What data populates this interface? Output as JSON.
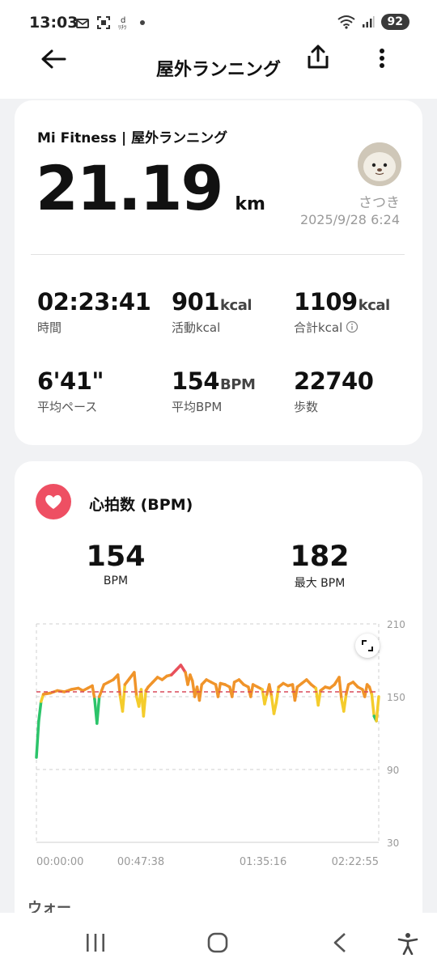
{
  "status_bar": {
    "time": "13:03",
    "battery": "92",
    "icons": [
      "mail-icon",
      "screenshot-icon",
      "d-app-icon",
      "dot-icon",
      "wifi-icon",
      "signal-icon"
    ]
  },
  "header": {
    "title": "屋外ランニング",
    "icons": [
      "back-arrow-icon",
      "share-icon",
      "more-vertical-icon"
    ]
  },
  "summary": {
    "source": "Mi Fitness | 屋外ランニング",
    "distance": "21.19",
    "distance_unit": "km",
    "user_name": "さつき",
    "datetime": "2025/9/28 6:24",
    "stats": [
      {
        "value": "02:23:41",
        "unit": "",
        "label": "時間"
      },
      {
        "value": "901",
        "unit": "kcal",
        "label": "活動kcal"
      },
      {
        "value": "1109",
        "unit": "kcal",
        "label": "合計kcal"
      },
      {
        "value": "6'41\"",
        "unit": "",
        "label": "平均ペース"
      },
      {
        "value": "154",
        "unit": "BPM",
        "label": "平均BPM"
      },
      {
        "value": "22740",
        "unit": "",
        "label": "歩数"
      }
    ]
  },
  "heart": {
    "title": "心拍数 (BPM)",
    "avg_value": "154",
    "avg_label": "BPM",
    "max_value": "182",
    "max_label": "最大 BPM"
  },
  "chart_data": {
    "type": "line",
    "title": "",
    "xlabel": "",
    "ylabel": "",
    "ylim": [
      30,
      210
    ],
    "y_ticks": [
      "210",
      "150",
      "90",
      "30"
    ],
    "x_ticks": [
      "00:00:00",
      "00:47:38",
      "01:35:16",
      "02:22:55"
    ],
    "reference_line": {
      "value": 154,
      "color": "#d94a5a"
    },
    "series": [
      {
        "values": [
          [
            0,
            100
          ],
          [
            1,
            130
          ],
          [
            2,
            146
          ],
          [
            3,
            152
          ],
          [
            6,
            153
          ],
          [
            9,
            155
          ],
          [
            12,
            154
          ],
          [
            15,
            156
          ],
          [
            18,
            157
          ],
          [
            20,
            155
          ],
          [
            22,
            157
          ],
          [
            24,
            159
          ],
          [
            25,
            148
          ],
          [
            26,
            128
          ],
          [
            27,
            150
          ],
          [
            29,
            160
          ],
          [
            31,
            162
          ],
          [
            33,
            164
          ],
          [
            35,
            168
          ],
          [
            36,
            150
          ],
          [
            37,
            138
          ],
          [
            38,
            160
          ],
          [
            40,
            165
          ],
          [
            42,
            170
          ],
          [
            43,
            150
          ],
          [
            44,
            142
          ],
          [
            45,
            156
          ],
          [
            46,
            134
          ],
          [
            47,
            155
          ],
          [
            48,
            158
          ],
          [
            50,
            162
          ],
          [
            52,
            166
          ],
          [
            54,
            164
          ],
          [
            56,
            167
          ],
          [
            58,
            168
          ],
          [
            60,
            172
          ],
          [
            62,
            176
          ],
          [
            64,
            170
          ],
          [
            65,
            160
          ],
          [
            66,
            168
          ],
          [
            67,
            163
          ],
          [
            68,
            150
          ],
          [
            69,
            158
          ],
          [
            70,
            147
          ],
          [
            71,
            160
          ],
          [
            73,
            164
          ],
          [
            75,
            162
          ],
          [
            77,
            160
          ],
          [
            78,
            150
          ],
          [
            79,
            161
          ],
          [
            81,
            160
          ],
          [
            83,
            158
          ],
          [
            84,
            150
          ],
          [
            85,
            162
          ],
          [
            87,
            164
          ],
          [
            89,
            160
          ],
          [
            91,
            158
          ],
          [
            92,
            150
          ],
          [
            93,
            160
          ],
          [
            95,
            158
          ],
          [
            97,
            156
          ],
          [
            98,
            144
          ],
          [
            99,
            152
          ],
          [
            100,
            160
          ],
          [
            101,
            150
          ],
          [
            102,
            136
          ],
          [
            103,
            145
          ],
          [
            104,
            158
          ],
          [
            106,
            161
          ],
          [
            108,
            159
          ],
          [
            110,
            160
          ],
          [
            111,
            147
          ],
          [
            112,
            158
          ],
          [
            114,
            161
          ],
          [
            116,
            164
          ],
          [
            118,
            160
          ],
          [
            120,
            157
          ],
          [
            121,
            143
          ],
          [
            122,
            155
          ],
          [
            124,
            158
          ],
          [
            126,
            157
          ],
          [
            128,
            160
          ],
          [
            130,
            166
          ],
          [
            131,
            148
          ],
          [
            132,
            138
          ],
          [
            133,
            152
          ],
          [
            134,
            160
          ],
          [
            136,
            162
          ],
          [
            138,
            158
          ],
          [
            140,
            156
          ],
          [
            141,
            150
          ],
          [
            142,
            160
          ],
          [
            143,
            158
          ],
          [
            144,
            152
          ],
          [
            145,
            134
          ],
          [
            146,
            130
          ],
          [
            147,
            150
          ]
        ],
        "unit": "BPM"
      }
    ],
    "colors": {
      "low": "#4aa3e0",
      "easy": "#2cc46a",
      "moderate": "#f4cc2c",
      "hard": "#f0942a",
      "max": "#e8505b"
    }
  },
  "next_section": "ウォー",
  "nav": {
    "icons": [
      "recent-apps-icon",
      "home-icon",
      "back-icon",
      "accessibility-icon"
    ]
  }
}
